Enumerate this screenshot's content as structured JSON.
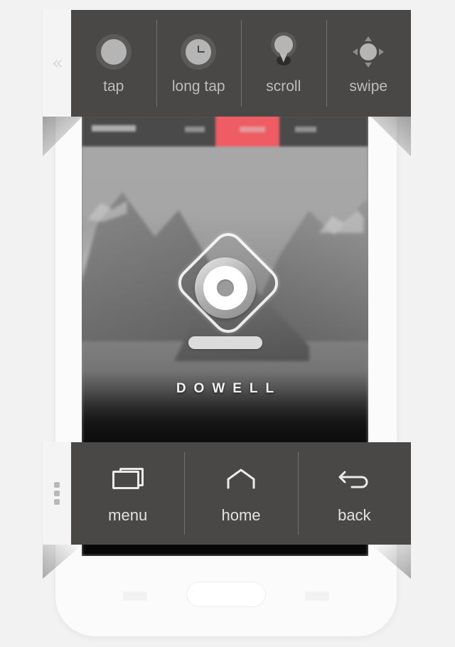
{
  "app": {
    "background_color": "#f2f2f2",
    "toolbar_color": "#4a4846",
    "accent_color": "#ef5c63"
  },
  "top_toolbar": {
    "handle": {
      "icon": "chevron-double-left-icon",
      "glyph": "«"
    },
    "items": [
      {
        "label": "tap",
        "icon": "tap-circle-icon"
      },
      {
        "label": "long tap",
        "icon": "clock-icon"
      },
      {
        "label": "scroll",
        "icon": "map-pin-icon"
      },
      {
        "label": "swipe",
        "icon": "four-arrows-icon"
      }
    ]
  },
  "bottom_toolbar": {
    "handle": {
      "icon": "drag-dots-icon"
    },
    "items": [
      {
        "label": "menu",
        "icon": "recents-squares-icon"
      },
      {
        "label": "home",
        "icon": "home-outline-icon"
      },
      {
        "label": "back",
        "icon": "back-arrow-icon"
      }
    ]
  },
  "phone": {
    "screen": {
      "wordmark": "DOWELL",
      "brand_icon": "eye-diamond-icon",
      "wallpaper": "grayscale-mountain-photo"
    },
    "hardware": {
      "home_button": "home-hardware-button",
      "left_capacitive_key": "menu-capacitive-key",
      "right_capacitive_key": "back-capacitive-key"
    }
  }
}
